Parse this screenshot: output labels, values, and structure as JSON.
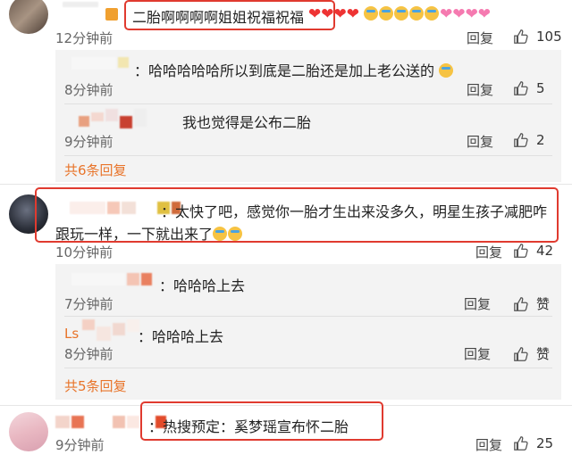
{
  "comments": [
    {
      "text_prefix": "",
      "text": "二胎啊啊啊啊姐姐祝福祝福",
      "time": "12分钟前",
      "reply_label": "回复",
      "likes": "105",
      "replies": [
        {
          "text": "哈哈哈哈哈所以到底是二胎还是加上老公送的",
          "time": "8分钟前",
          "reply_label": "回复",
          "likes": "5"
        },
        {
          "text": "我也觉得是公布二胎",
          "time": "9分钟前",
          "reply_label": "回复",
          "likes": "2"
        }
      ],
      "more_label": "共6条回复"
    },
    {
      "text_line1": "：太快了吧，感觉你一胎才生出来没多久，明星生孩子减肥咋",
      "text_line2": "跟玩一样，一下就出来了",
      "time": "10分钟前",
      "reply_label": "回复",
      "likes": "42",
      "replies": [
        {
          "text": "哈哈哈上去",
          "time": "7分钟前",
          "reply_label": "回复",
          "likes": "赞"
        },
        {
          "name_fragment": "Ls",
          "text": "哈哈哈上去",
          "time": "8分钟前",
          "reply_label": "回复",
          "likes": "赞"
        }
      ],
      "more_label": "共5条回复"
    },
    {
      "text": "：热搜预定：奚梦瑶宣布怀二胎",
      "time": "9分钟前",
      "reply_label": "回复",
      "likes": "25"
    }
  ],
  "colors": {
    "highlight_box": "#e03a2f",
    "link_orange": "#e8742a",
    "panel_bg": "#f3f3f3"
  },
  "icons": [
    "thumbs-up-icon",
    "heart-emoji",
    "laughing-crying-emoji",
    "pink-heart-emoji"
  ]
}
